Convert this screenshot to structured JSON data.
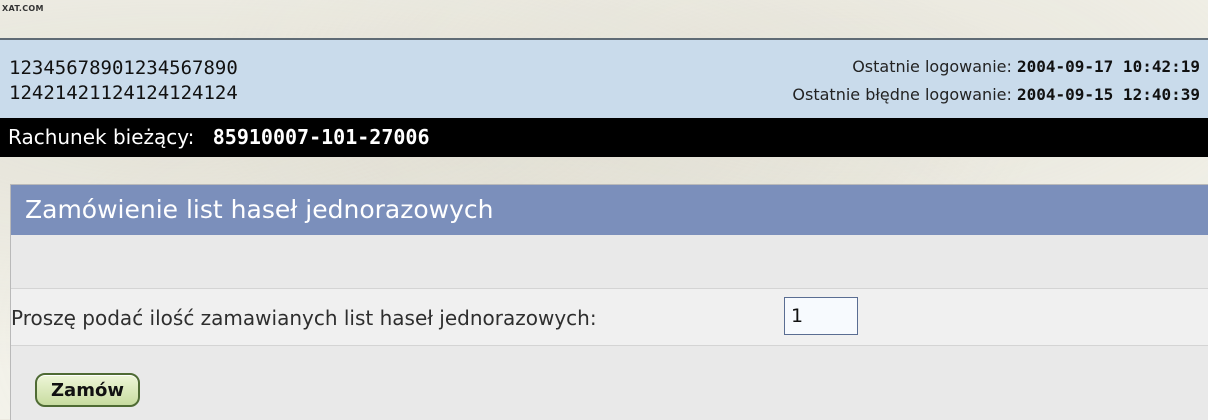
{
  "brand": "XAT.COM",
  "user": {
    "id_line1": "12345678901234567890",
    "id_line2": "12421421124124124124",
    "last_login_label": "Ostatnie logowanie:",
    "last_login_value": "2004-09-17 10:42:19",
    "last_failed_login_label": "Ostatnie błędne logowanie:",
    "last_failed_login_value": "2004-09-15 12:40:39"
  },
  "account": {
    "label": "Rachunek bieżący:",
    "number": "85910007-101-27006"
  },
  "panel": {
    "title": "Zamówienie list haseł jednorazowych",
    "quantity_label": "Proszę podać ilość zamawianych list haseł jednorazowych:",
    "quantity_value": "1",
    "submit_label": "Zamów"
  },
  "colors": {
    "user_bar_bg": "#c9dbeb",
    "account_bar_bg": "#000000",
    "panel_title_bg": "#7b8fbb",
    "button_border": "#4f6b34"
  }
}
